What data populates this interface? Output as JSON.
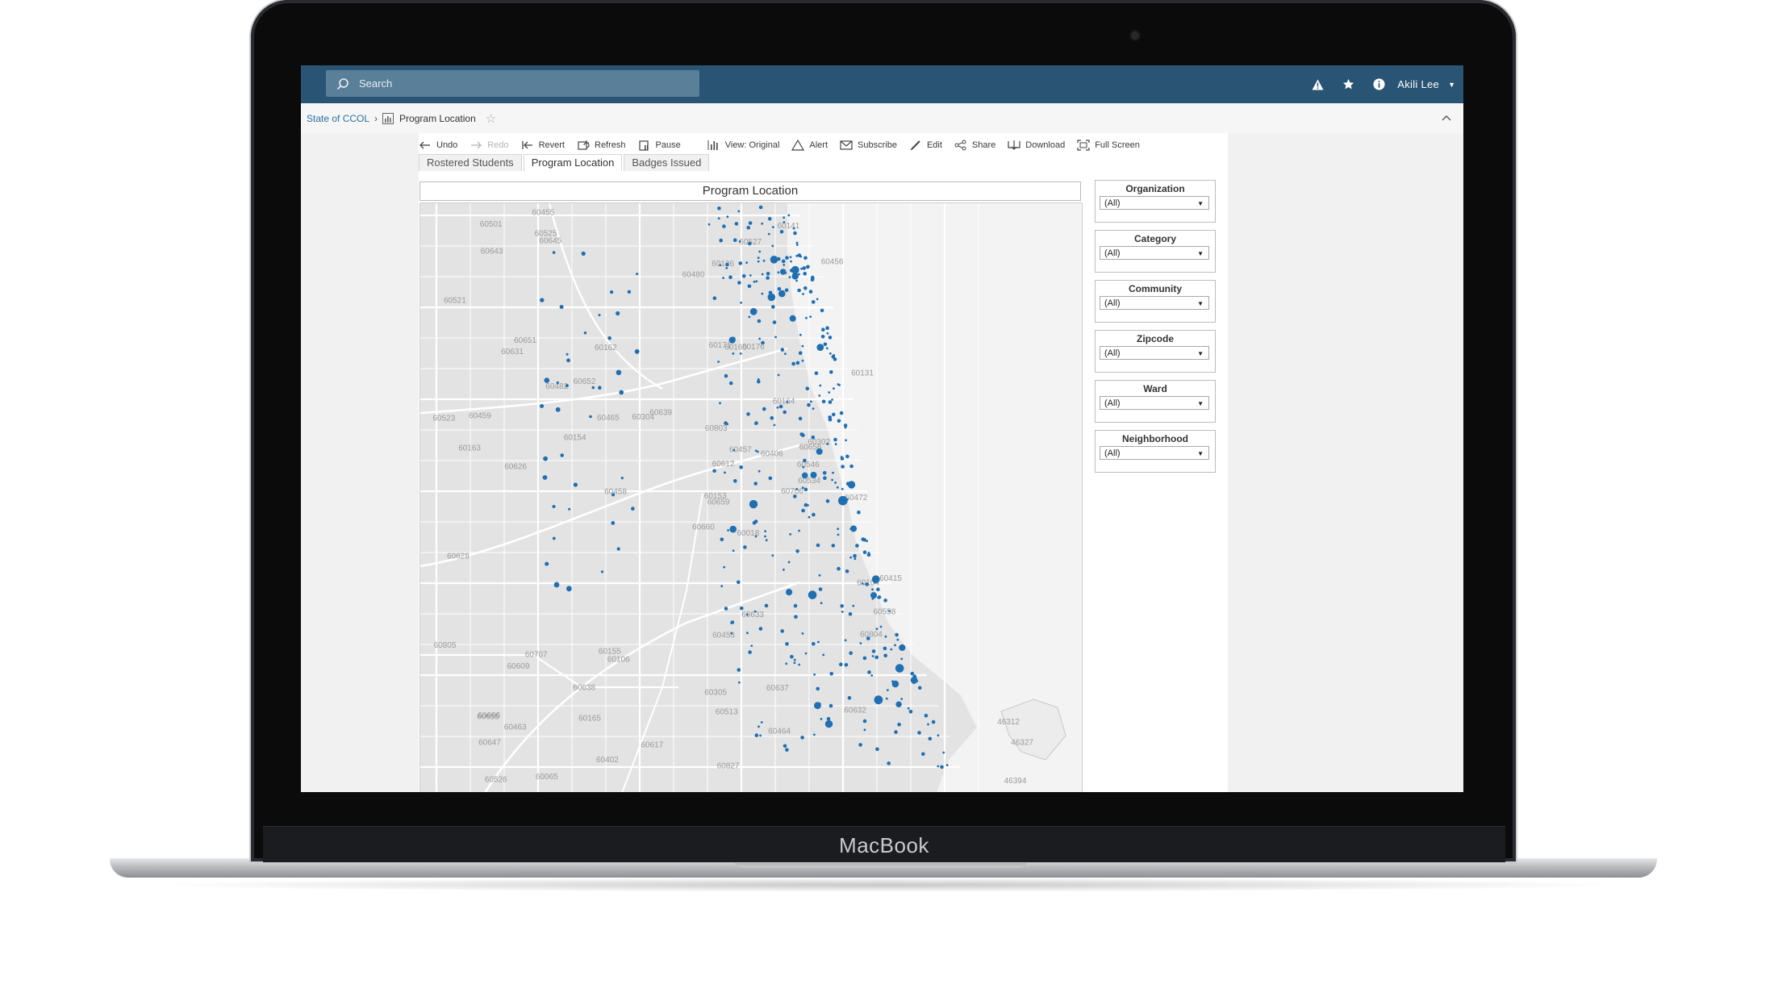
{
  "device": {
    "brand": "MacBook"
  },
  "topbar": {
    "search_placeholder": "Search",
    "user_name": "Akili Lee"
  },
  "breadcrumb": {
    "project": "State of CCOL",
    "separator": "›",
    "sheet": "Program Location"
  },
  "toolbar": {
    "undo": "Undo",
    "redo": "Redo",
    "revert": "Revert",
    "refresh": "Refresh",
    "pause": "Pause",
    "view": "View: Original",
    "alert": "Alert",
    "subscribe": "Subscribe",
    "edit": "Edit",
    "share": "Share",
    "download": "Download",
    "fullscreen": "Full Screen"
  },
  "tabs": [
    {
      "label": "Rostered Students",
      "active": false
    },
    {
      "label": "Program Location",
      "active": true
    },
    {
      "label": "Badges Issued",
      "active": false
    }
  ],
  "viz": {
    "title": "Program Location",
    "marker_color": "#1f6fb2",
    "zip_labels": [
      "60018",
      "60631",
      "60659",
      "60666",
      "60656",
      "60106",
      "60176",
      "60706",
      "60645",
      "60626",
      "60660",
      "60131",
      "60065",
      "60171",
      "60164",
      "60707",
      "60639",
      "60647",
      "60165",
      "60160",
      "60302",
      "60651",
      "60126",
      "60163",
      "60104",
      "60153",
      "60305",
      "60612",
      "60162",
      "60155",
      "60141",
      "60304",
      "60154",
      "60804",
      "60402",
      "60523",
      "60546",
      "60526",
      "60513",
      "60534",
      "60609",
      "60521",
      "60558",
      "60632",
      "60638",
      "60525",
      "60501",
      "60637",
      "60527",
      "60458",
      "60459",
      "60652",
      "60455",
      "60456",
      "60480",
      "60457",
      "60805",
      "60453",
      "60617",
      "60415",
      "60465",
      "60655",
      "60643",
      "60482",
      "60628",
      "60803",
      "60464",
      "60406",
      "60463",
      "60472",
      "60827",
      "60633",
      "46394",
      "46312",
      "46327"
    ]
  },
  "filters": [
    {
      "label": "Organization",
      "value": "(All)"
    },
    {
      "label": "Category",
      "value": "(All)"
    },
    {
      "label": "Community",
      "value": "(All)"
    },
    {
      "label": "Zipcode",
      "value": "(All)"
    },
    {
      "label": "Ward",
      "value": "(All)"
    },
    {
      "label": "Neighborhood",
      "value": "(All)"
    }
  ]
}
